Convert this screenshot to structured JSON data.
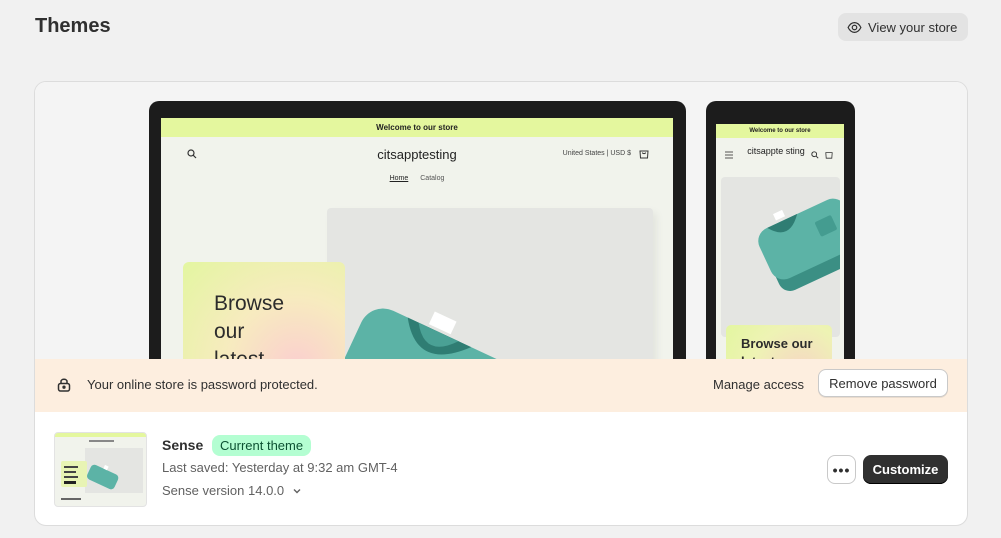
{
  "page": {
    "title": "Themes"
  },
  "header": {
    "view_store_label": "View your store"
  },
  "preview": {
    "desktop": {
      "announcement": "Welcome to our store",
      "store_name": "citsapptesting",
      "region": "United States | USD $",
      "nav": [
        "Home",
        "Catalog"
      ],
      "hero_text": "Browse our latest"
    },
    "mobile": {
      "announcement": "Welcome to our store",
      "store_name": "citsappte sting",
      "hero_text": "Browse our latest"
    }
  },
  "password_banner": {
    "message": "Your online store is password protected.",
    "manage_access_label": "Manage access",
    "remove_password_label": "Remove password"
  },
  "theme": {
    "name": "Sense",
    "badge": "Current theme",
    "last_saved": "Last saved: Yesterday at 9:32 am GMT-4",
    "version": "Sense version 14.0.0",
    "customize_label": "Customize",
    "more_label": "•••"
  },
  "colors": {
    "accent_primary": "#303030",
    "badge_bg": "#b4fed2",
    "announcement_bg": "#e4f79e",
    "banner_bg": "#fdeedf",
    "sweater_teal": "#5cb3a6"
  }
}
